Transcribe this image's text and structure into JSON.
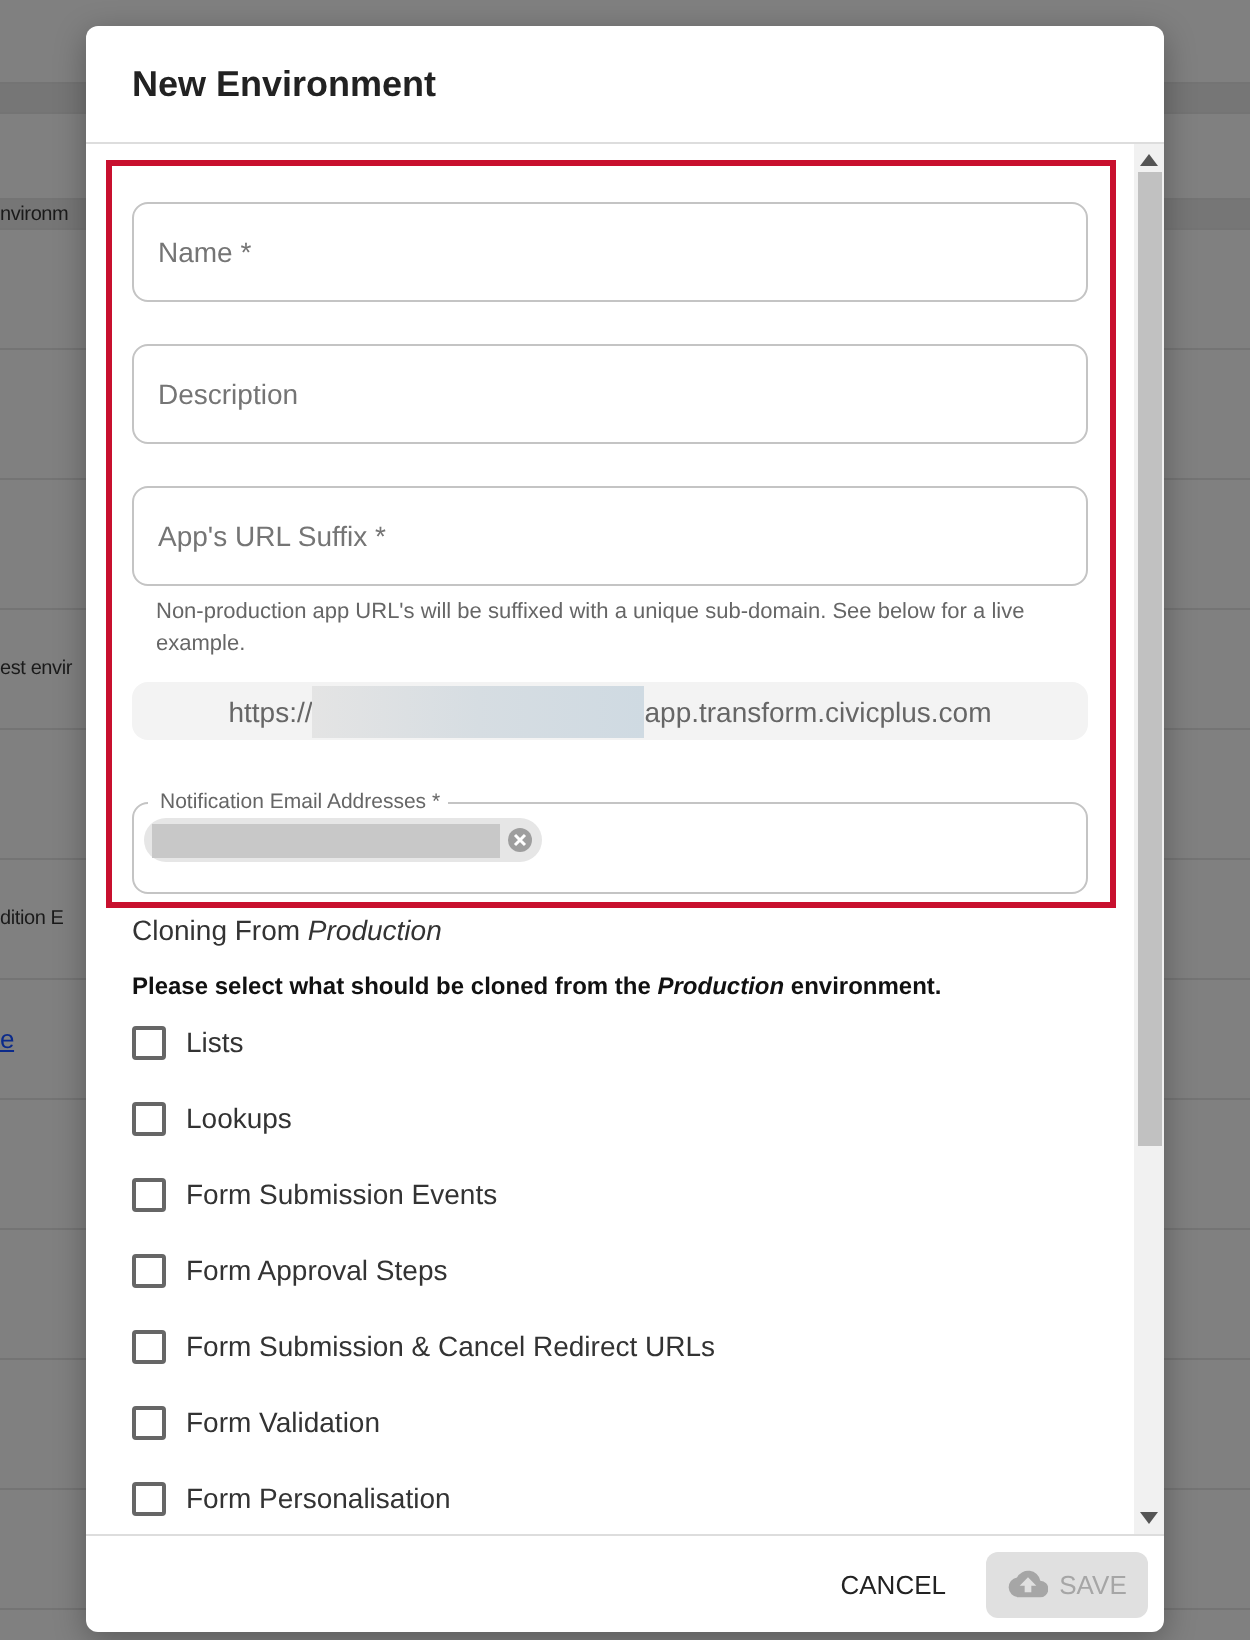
{
  "background": {
    "fragments": [
      {
        "kind": "text",
        "text": "nvironm"
      },
      {
        "kind": "text",
        "text": "est envir"
      },
      {
        "kind": "text",
        "text": "dition E"
      },
      {
        "kind": "link",
        "text": "e"
      }
    ]
  },
  "dialog": {
    "title": "New Environment",
    "fields": [
      {
        "placeholder": "Name *"
      },
      {
        "placeholder": "Description"
      },
      {
        "placeholder": "App's URL Suffix *",
        "helper": "Non-production app URL's will be suffixed with a unique sub-domain. See below for a live example."
      }
    ],
    "url_preview": {
      "prefix": "https://",
      "suffix": "app.transform.civicplus.com"
    },
    "email_field": {
      "label": "Notification Email Addresses *",
      "chips": [
        {
          "kind": "redacted"
        }
      ]
    },
    "cloning": {
      "heading": "Cloning From *Production*",
      "instruction": "Please select what should be cloned from the *Production* environment.",
      "options": [
        {
          "label": "Lists",
          "checked": false
        },
        {
          "label": "Lookups",
          "checked": false
        },
        {
          "label": "Form Submission Events",
          "checked": false
        },
        {
          "label": "Form Approval Steps",
          "checked": false
        },
        {
          "label": "Form Submission & Cancel Redirect URLs",
          "checked": false
        },
        {
          "label": "Form Validation",
          "checked": false
        },
        {
          "label": "Form Personalisation",
          "checked": false
        }
      ]
    },
    "buttons": [
      {
        "kind": "text",
        "label": "CANCEL",
        "disabled": false
      },
      {
        "kind": "save",
        "label": "SAVE",
        "disabled": true
      }
    ]
  }
}
